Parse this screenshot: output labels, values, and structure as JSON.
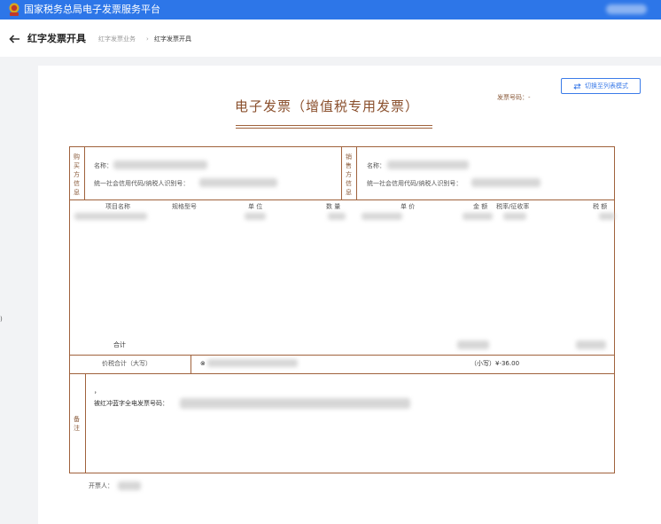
{
  "topbar": {
    "title": "国家税务总局电子发票服务平台",
    "user_name": ""
  },
  "subheader": {
    "page_title": "红字发票开具",
    "breadcrumb": [
      "红字发票业务",
      "红字发票开具"
    ],
    "breadcrumb_sep": "›"
  },
  "toolbar": {
    "switch_label": "切换至列表模式"
  },
  "invoice": {
    "title": "电子发票（增值税专用发票）",
    "number_label": "发票号码：",
    "number_value": "-",
    "buyer": {
      "section_label": "购买方信息",
      "name_label": "名称：",
      "name_value": "",
      "taxid_label": "统一社会信用代码/纳税人识别号：",
      "taxid_value": ""
    },
    "seller": {
      "section_label": "销售方信息",
      "name_label": "名称：",
      "name_value": "",
      "taxid_label": "统一社会信用代码/纳税人识别号：",
      "taxid_value": ""
    },
    "columns": [
      "项目名称",
      "规格型号",
      "单 位",
      "数 量",
      "单 价",
      "金 额",
      "税率/征收率",
      "税 额"
    ],
    "items": [
      {
        "name": "",
        "spec": "",
        "unit": "",
        "qty": "",
        "price": "",
        "amount": "",
        "rate": "",
        "tax": ""
      }
    ],
    "total_label": "合计",
    "total_amount": "",
    "total_tax": "",
    "grand_total_label": "价税合计（大写）",
    "grand_total_symbol": "⊗",
    "grand_total_words": "",
    "small_label": "（小写）",
    "small_value": "¥-36.00",
    "remarks_label": "备注",
    "remarks_mark": "，",
    "remarks_text_label": "被红冲蓝字全电发票号码：",
    "remarks_value": ""
  },
  "drawer": {
    "label": "开票人：",
    "value": ""
  },
  "side_mark": ")",
  "colors": {
    "primary": "#2d76e8",
    "invoice_line": "#a0623c",
    "invoice_text": "#8a4f2c",
    "link": "#3b7be8"
  }
}
